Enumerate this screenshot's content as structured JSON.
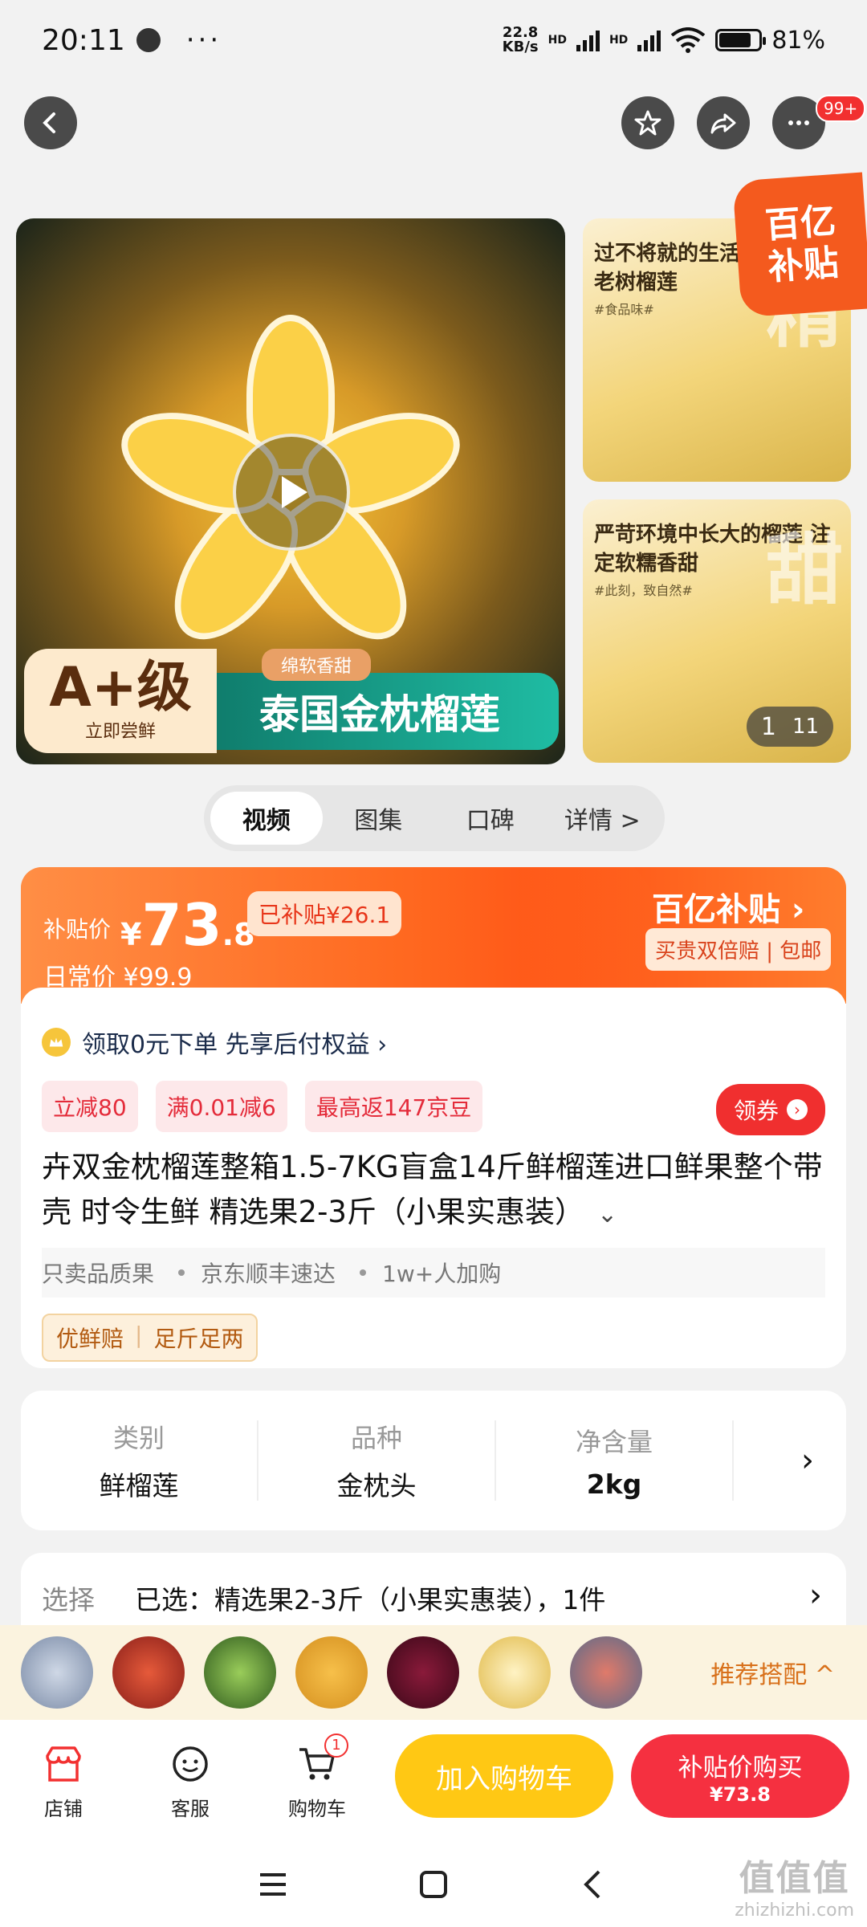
{
  "status_bar": {
    "time": "20:11",
    "dots": "···",
    "net_speed_value": "22.8",
    "net_speed_unit": "KB/s",
    "hd1": "HD",
    "hd2": "HD",
    "battery": "81%",
    "battery_level": 0.81
  },
  "nav": {
    "more_badge": "99+"
  },
  "gallery": {
    "main_grade": "A+级",
    "main_grade_sub": "立即尝鲜",
    "main_tag": "绵软香甜",
    "main_banner": "泰国金枕榴莲",
    "side1_caption": "过不将就的生活 从精选的老树榴莲",
    "side1_mini": "#食品味#",
    "side1_big": "精",
    "side2_caption": "严苛环境中长大的榴莲 注定软糯香甜",
    "side2_mini": "#此刻，致自然#",
    "side2_big": "甜",
    "counter_current": "1",
    "counter_total": "11",
    "corner_line1": "百亿",
    "corner_line2": "补贴"
  },
  "tabs": [
    {
      "label": "视频",
      "active": true
    },
    {
      "label": "图集",
      "active": false
    },
    {
      "label": "口碑",
      "active": false
    },
    {
      "label": "详情 >",
      "active": false
    }
  ],
  "price": {
    "subsidy_label": "补贴价",
    "yen": "¥",
    "int": "73",
    "dec": ".8",
    "subsidy_amount": "已补贴¥26.1",
    "regular": "日常价 ¥99.9",
    "logo": "百亿补贴",
    "guarantee": "买贵双倍赔 | 包邮"
  },
  "info": {
    "pay_later": "领取0元下单 先享后付权益 ›",
    "coupons": [
      "立减80",
      "满0.01减6",
      "最高返147京豆"
    ],
    "get_coupon": "领券",
    "title": "卉双金枕榴莲整箱1.5-7KG盲盒14斤鲜榴莲进口鲜果整个带壳 时令生鲜 精选果2-3斤（小果实惠装）",
    "features": [
      "只卖品质果",
      "京东顺丰速达",
      "1w+人加购"
    ],
    "fresh_tags": [
      "优鲜赔",
      "足斤足两"
    ]
  },
  "specs": [
    {
      "key": "类别",
      "value": "鲜榴莲"
    },
    {
      "key": "品种",
      "value": "金枕头"
    },
    {
      "key": "净含量",
      "value": "2kg"
    }
  ],
  "select": {
    "label": "选择",
    "value": "已选：精选果2-3斤（小果实惠装），1件"
  },
  "recommend": {
    "label": "推荐搭配 ^"
  },
  "actions": {
    "store": "店铺",
    "service": "客服",
    "cart": "购物车",
    "cart_count": "1",
    "add_to_cart": "加入购物车",
    "buy_label": "补贴价购买",
    "buy_price": "¥73.8"
  },
  "watermark": {
    "big": "值值值",
    "small": "zhizhizhi.com"
  }
}
